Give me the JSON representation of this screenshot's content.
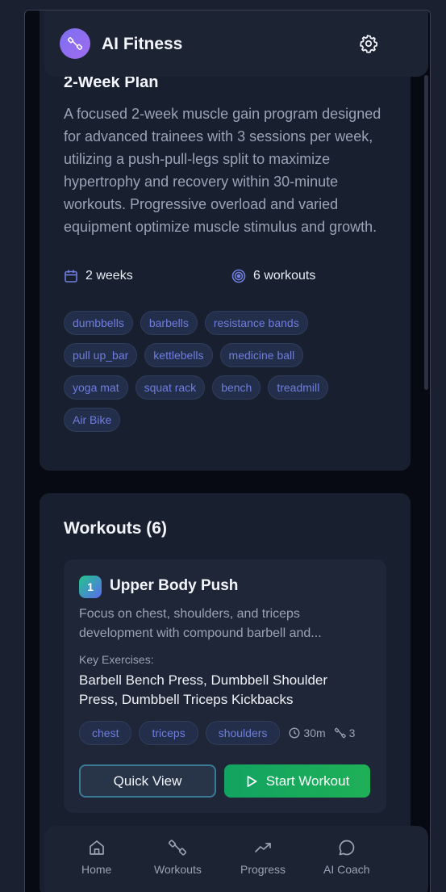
{
  "app": {
    "title": "AI Fitness"
  },
  "plan": {
    "title": "2-Week Plan",
    "description": "A focused 2-week muscle gain program designed for advanced trainees with 3 sessions per week, utilizing a push-pull-legs split to maximize hypertrophy and recovery within 30-minute workouts. Progressive overload and varied equipment optimize muscle stimulus and growth.",
    "duration": "2 weeks",
    "workouts_count": "6 workouts",
    "equipment": [
      "dumbbells",
      "barbells",
      "resistance bands",
      "pull up_bar",
      "kettlebells",
      "medicine ball",
      "yoga mat",
      "squat rack",
      "bench",
      "treadmill",
      "Air Bike"
    ]
  },
  "workouts": {
    "title": "Workouts (6)",
    "items": [
      {
        "number": "1",
        "title": "Upper Body Push",
        "description": "Focus on chest, shoulders, and triceps development with compound barbell and...",
        "key_label": "Key Exercises:",
        "key_exercises": "Barbell Bench Press, Dumbbell Shoulder Press, Dumbbell Triceps Kickbacks",
        "tags": [
          "chest",
          "triceps",
          "shoulders"
        ],
        "duration": "30m",
        "exercise_count": "3",
        "quick_view_label": "Quick View",
        "start_label": "Start Workout"
      }
    ]
  },
  "nav": {
    "items": [
      {
        "label": "Home",
        "icon": "home-icon"
      },
      {
        "label": "Workouts",
        "icon": "dumbbell-icon"
      },
      {
        "label": "Progress",
        "icon": "trending-up-icon"
      },
      {
        "label": "AI Coach",
        "icon": "chat-icon"
      }
    ]
  },
  "colors": {
    "accent": "#6f7dde",
    "start": "#12a361",
    "background": "#070a12",
    "card": "#182030"
  }
}
